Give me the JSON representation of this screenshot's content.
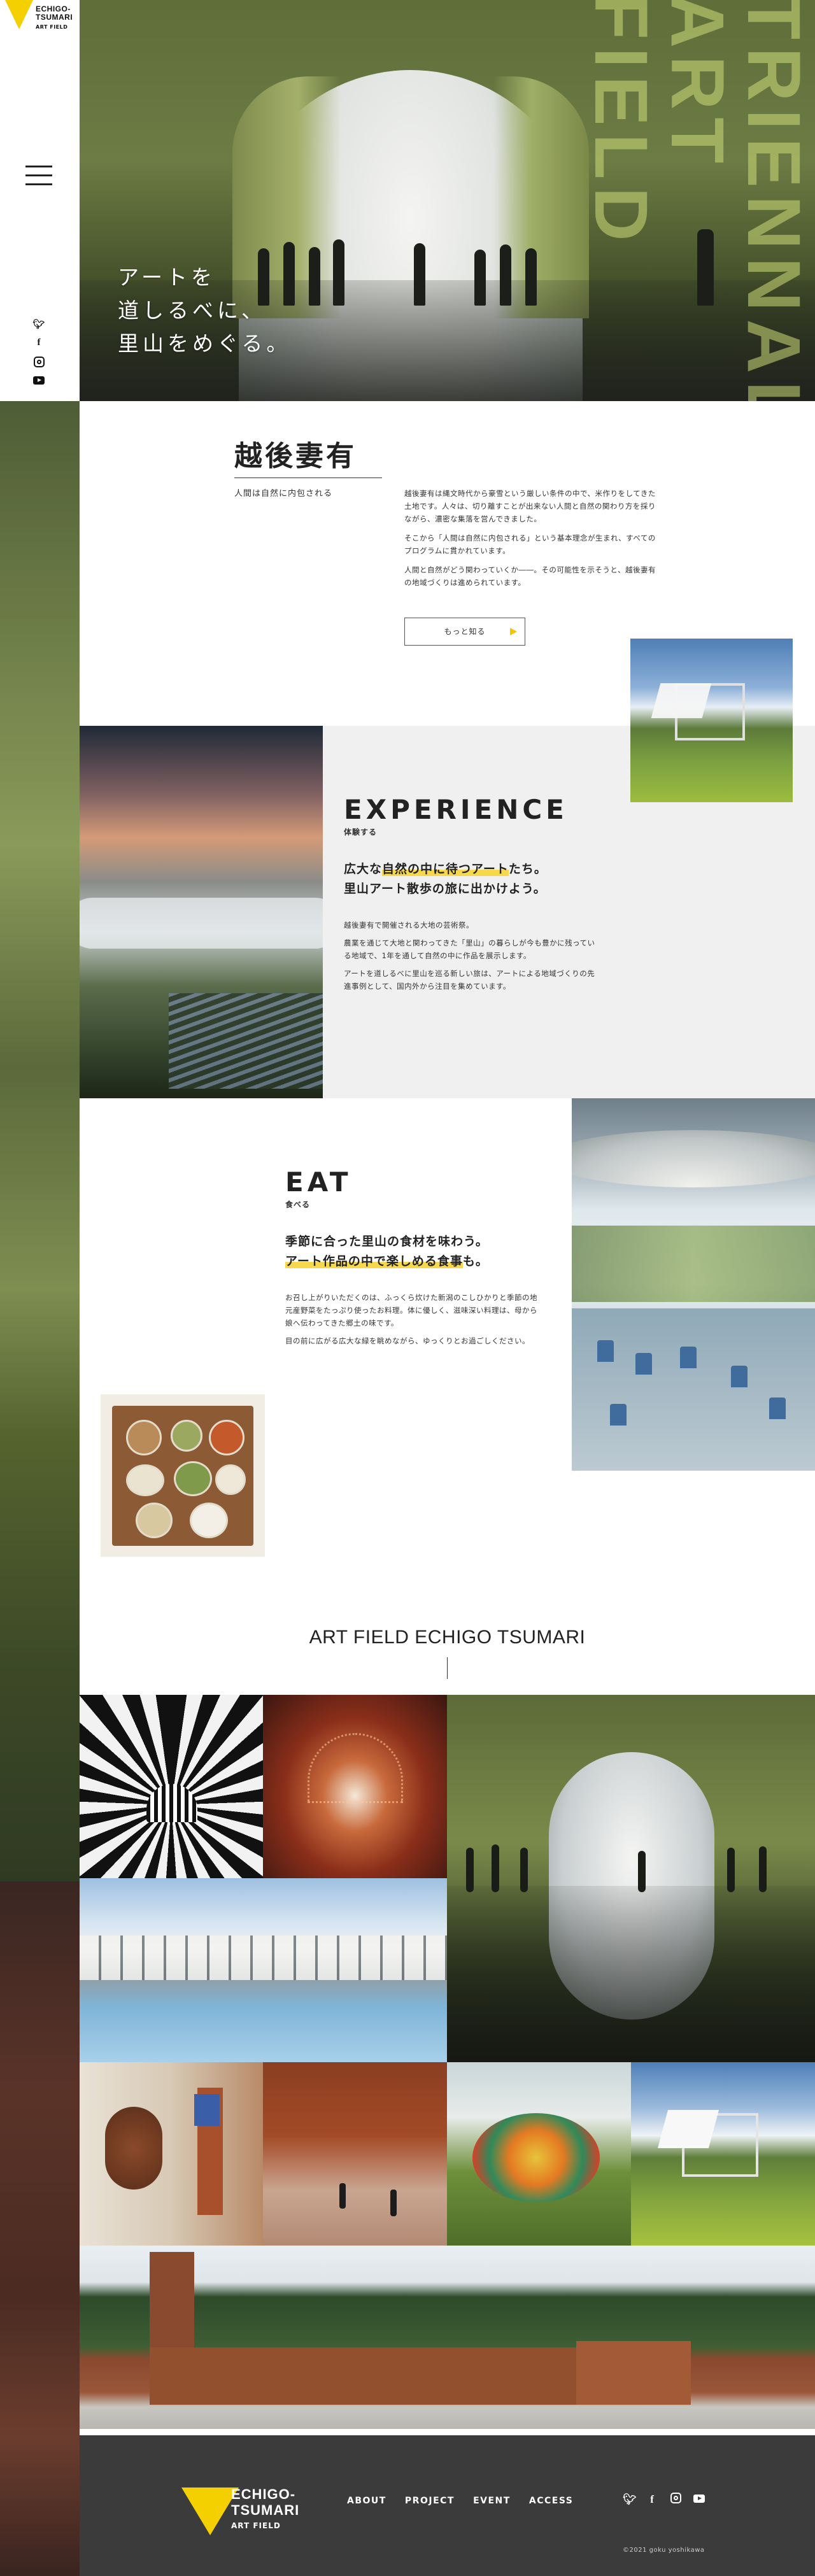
{
  "brand": {
    "logo_line1": "ECHIGO-",
    "logo_line2": "TSUMARI",
    "logo_sub": "ART FIELD"
  },
  "hero": {
    "copy_line1": "アートを",
    "copy_line2": "道しるべに、",
    "copy_line3": "里山をめぐる。",
    "vertical_text": "TRIENNALE ART FIELD"
  },
  "about": {
    "title": "越後妻有",
    "subtitle": "人間は自然に内包される",
    "body_p1": "越後妻有は縄文時代から豪雪という厳しい条件の中で、米作りをしてきた土地です。人々は、切り離すことが出来ない人間と自然の関わり方を採りながら、濃密な集落を営んできました。",
    "body_p2": "そこから「人間は自然に内包される」という基本理念が生まれ、すべてのプログラムに貫かれています。",
    "body_p3": "人間と自然がどう関わっていくか――。その可能性を示そうと、越後妻有の地域づくりは進められています。",
    "more_button": "もっと知る"
  },
  "experience": {
    "title": "EXPERIENCE",
    "subtitle": "体験する",
    "lead_pre": "広大な",
    "lead_hl": "自然の中に待つアート",
    "lead_post": "たち。",
    "lead_line2": "里山アート散歩の旅に出かけよう。",
    "body_p1": "越後妻有で開催される大地の芸術祭。",
    "body_p2": "農業を通じて大地と関わってきた「里山」の暮らしが今も豊かに残っている地域で、1年を通して自然の中に作品を展示します。",
    "body_p3": "アートを道しるべに里山を巡る新しい旅は、アートによる地域づくりの先進事例として、国内外から注目を集めています。"
  },
  "eat": {
    "title": "EAT",
    "subtitle": "食べる",
    "lead_line1": "季節に合った里山の食材を味わう。",
    "lead_hl": "アート作品の中で楽しめる食事",
    "lead_post": "も。",
    "body_p1": "お召し上がりいただくのは、ふっくら炊けた新潟のこしひかりと季節の地元産野菜をたっぷり使ったお料理。体に優しく、滋味深い料理は、母から娘へ伝わってきた郷土の味です。",
    "body_p2": "目の前に広がる広大な緑を眺めながら、ゆっくりとお過ごしください。"
  },
  "gallery": {
    "title": "ART FIELD ECHIGO TSUMARI"
  },
  "footer": {
    "nav": [
      "ABOUT",
      "PROJECT",
      "EVENT",
      "ACCESS"
    ],
    "copyright": "©2021 goku yoshikawa"
  },
  "icons": {
    "menu": "hamburger-icon",
    "social": [
      "twitter-icon",
      "facebook-icon",
      "instagram-icon",
      "youtube-icon"
    ],
    "button_arrow": "triangle-right-icon"
  },
  "colors": {
    "accent": "#f5d000",
    "highlight": "#f7d84d",
    "footer_bg": "#3b3b3b",
    "section_gray": "#f0f0f0"
  }
}
